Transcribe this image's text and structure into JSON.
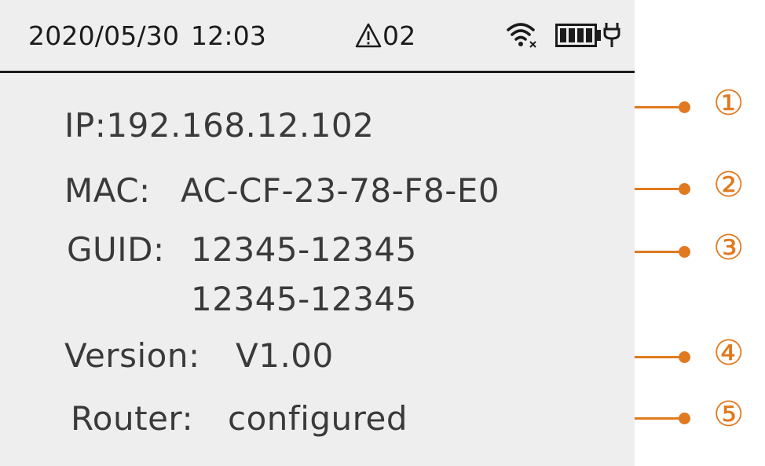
{
  "status_bar": {
    "date": "2020/05/30",
    "time": "12:03",
    "alarm_count": "02",
    "icons": [
      "warning-icon",
      "wifi-disconnected-icon",
      "battery-full-icon",
      "plug-icon"
    ]
  },
  "info": {
    "ip": "IP:192.168.12.102",
    "mac_label": "MAC:",
    "mac_value": "AC-CF-23-78-F8-E0",
    "guid_label": "GUID:",
    "guid_line1": "12345-12345",
    "guid_line2": "12345-12345",
    "version_label": "Version:",
    "version_value": "V1.00",
    "router_label": "Router:",
    "router_value": "configured"
  },
  "callouts": [
    "①",
    "②",
    "③",
    "④",
    "⑤"
  ],
  "colors": {
    "screen_bg": "#eeeeee",
    "text": "#3a3a3a",
    "accent": "#e07a20"
  }
}
